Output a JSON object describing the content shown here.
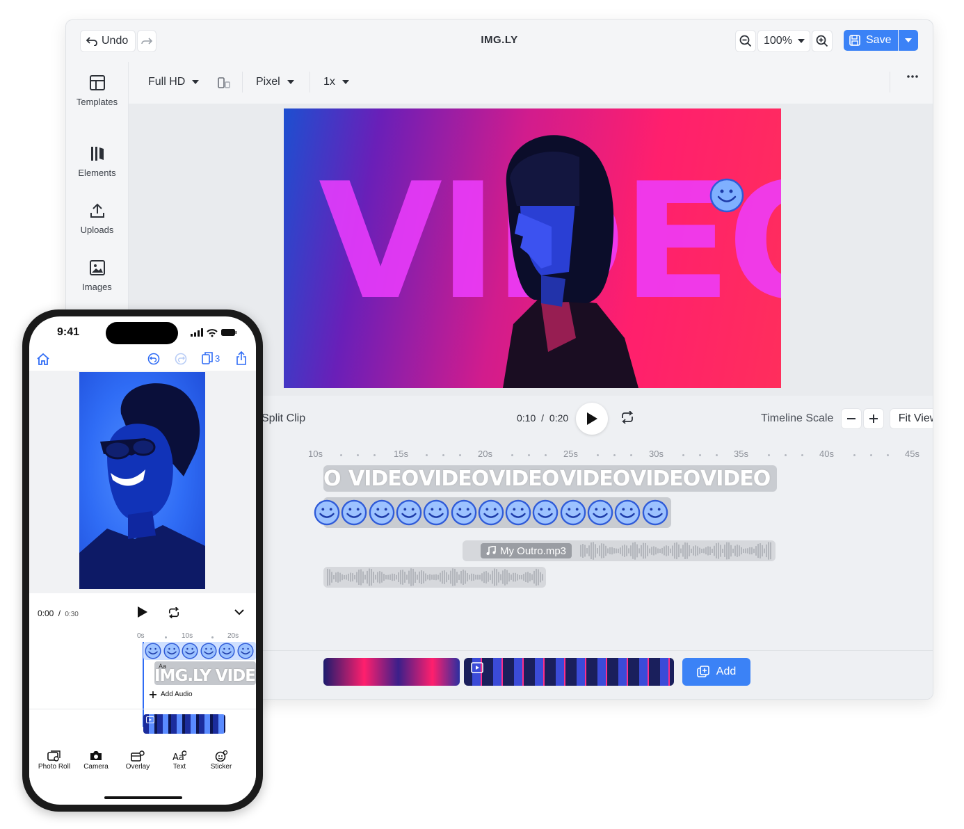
{
  "desktop": {
    "title": "IMG.LY",
    "undo_label": "Undo",
    "zoom": "100%",
    "save_label": "Save",
    "sidebar": [
      {
        "label": "Templates",
        "icon": "templates-icon"
      },
      {
        "label": "Elements",
        "icon": "elements-icon"
      },
      {
        "label": "Uploads",
        "icon": "upload-icon"
      },
      {
        "label": "Images",
        "icon": "image-icon"
      }
    ],
    "toolbar": {
      "format": "Full HD",
      "unit": "Pixel",
      "scale": "1x"
    },
    "canvas": {
      "overlay_text": "VIDEO"
    },
    "player": {
      "split_clip": "Split Clip",
      "current_time": "0:10",
      "separator": "/",
      "total_time": "0:20",
      "timeline_scale": "Timeline Scale",
      "fit_view": "Fit View"
    },
    "timeline": {
      "ticks": [
        "10s",
        "15s",
        "20s",
        "25s",
        "30s",
        "35s",
        "40s",
        "45s"
      ],
      "text_track": [
        "O",
        "VIDEO",
        "VIDEO",
        "VIDEO",
        "VIDEO",
        "VIDEO",
        "VIDEO"
      ],
      "audio_track_label": "My Outro.mp3"
    },
    "add_label": "Add",
    "colors": {
      "accent": "#3b82f6",
      "playhead": "#3b6fe8"
    }
  },
  "phone": {
    "status_time": "9:41",
    "pages_count": "3",
    "current_time": "0:00",
    "separator": "/",
    "total_time": "0:30",
    "ticks": [
      "0s",
      "10s",
      "20s"
    ],
    "text_clip": "IMG.LY VIDE",
    "text_clip_badge": "Aa",
    "add_audio": "Add Audio",
    "tools": [
      {
        "label": "Photo Roll",
        "icon": "photo-roll-icon"
      },
      {
        "label": "Camera",
        "icon": "camera-icon"
      },
      {
        "label": "Overlay",
        "icon": "overlay-icon"
      },
      {
        "label": "Text",
        "icon": "text-icon"
      },
      {
        "label": "Sticker",
        "icon": "sticker-icon"
      }
    ]
  }
}
